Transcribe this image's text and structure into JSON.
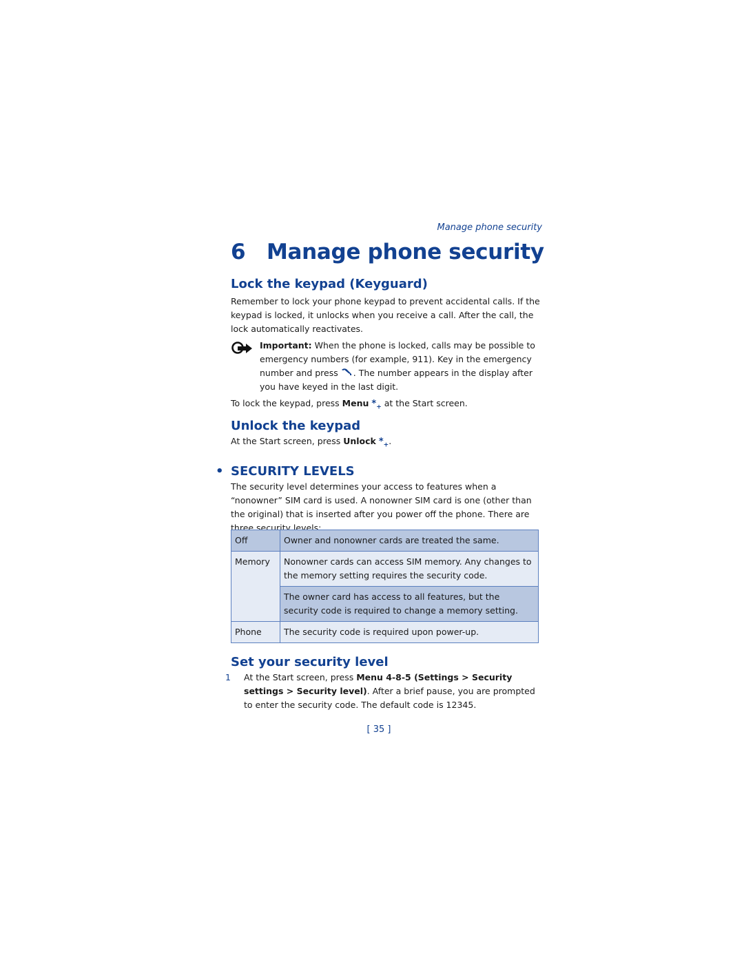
{
  "running_head": "Manage phone security",
  "chapter": {
    "number": "6",
    "title": "Manage phone security"
  },
  "sections": {
    "lock": {
      "heading": "Lock the keypad (Keyguard)",
      "body": "Remember to lock your phone keypad to prevent accidental calls. If the keypad is locked, it unlocks when you receive a call. After the call, the lock automatically reactivates.",
      "note_label": "Important:",
      "note_text_1": " When the phone is locked, calls may be possible to emergency numbers (for example, 911). Key in the emergency number and press ",
      "note_text_2": ". The number appears in the display after you have keyed in the last digit.",
      "instr_pre": "To lock the keypad, press ",
      "instr_key": "Menu",
      "instr_post": " at the Start screen."
    },
    "unlock": {
      "heading": "Unlock the keypad",
      "instr_pre": "At the Start screen, press ",
      "instr_key": "Unlock",
      "instr_post": "."
    },
    "levels": {
      "bullet": "•",
      "heading": "SECURITY LEVELS",
      "body": "The security level determines your access to features when a “nonowner” SIM card is used. A nonowner SIM card is one (other than the original) that is inserted after you power off the phone. There are three security levels:",
      "table": [
        {
          "label": "Off",
          "desc": "Owner and nonowner cards are treated the same."
        },
        {
          "label": "Memory",
          "desc": "Nonowner cards can access SIM memory. Any changes to the memory setting requires the security code.",
          "desc2": "The owner card has access to all features, but the security code is required to change a memory setting."
        },
        {
          "label": "Phone",
          "desc": "The security code is required upon power-up."
        }
      ]
    },
    "set_level": {
      "heading": "Set your security level",
      "steps": [
        {
          "num": "1",
          "pre": "At the Start screen, press ",
          "key": "Menu 4-8-5 (Settings > Security settings > Security level)",
          "post": ". After a brief pause, you are prompted to enter the security code. The default code is 12345."
        }
      ]
    }
  },
  "icons": {
    "note": "important-note-icon",
    "call": "call-key-icon",
    "star": "star-key-icon"
  },
  "page_number": "[ 35 ]",
  "colors": {
    "accent": "#124191",
    "table_shade": "#b8c7e0",
    "table_light": "#e5ebf5",
    "table_border": "#5b7fbf"
  }
}
